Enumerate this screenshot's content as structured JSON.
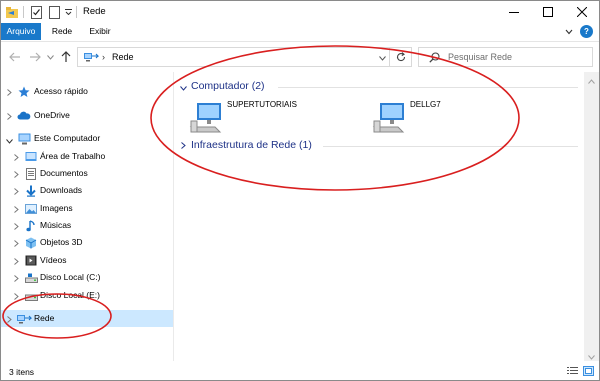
{
  "window": {
    "title": "Rede",
    "controls": {
      "minimize_icon": "minimize-icon",
      "maximize_icon": "maximize-icon",
      "close_icon": "close-icon"
    }
  },
  "ribbon": {
    "tabs": [
      {
        "label": "Arquivo",
        "active": true
      },
      {
        "label": "Rede",
        "active": false
      },
      {
        "label": "Exibir",
        "active": false
      }
    ]
  },
  "navigation": {
    "address_path": "Rede",
    "address_separator": "›",
    "search_placeholder": "Pesquisar Rede"
  },
  "sidebar": {
    "items": [
      {
        "label": "Acesso rápido",
        "icon": "star-icon",
        "selected": false
      },
      {
        "label": "OneDrive",
        "icon": "onedrive-cloud-icon",
        "selected": false
      },
      {
        "label": "Este Computador",
        "icon": "computer-icon",
        "selected": false,
        "expanded": true
      },
      {
        "label": "Área de Trabalho",
        "icon": "desktop-folder-icon",
        "selected": false
      },
      {
        "label": "Documentos",
        "icon": "documents-icon",
        "selected": false
      },
      {
        "label": "Downloads",
        "icon": "download-arrow-icon",
        "selected": false
      },
      {
        "label": "Imagens",
        "icon": "pictures-icon",
        "selected": false
      },
      {
        "label": "Músicas",
        "icon": "music-note-icon",
        "selected": false
      },
      {
        "label": "Objetos 3D",
        "icon": "3d-objects-icon",
        "selected": false
      },
      {
        "label": "Vídeos",
        "icon": "videos-icon",
        "selected": false
      },
      {
        "label": "Disco Local (C:)",
        "icon": "drive-icon",
        "selected": false
      },
      {
        "label": "Disco Local (E:)",
        "icon": "drive-icon",
        "selected": false
      },
      {
        "label": "Rede",
        "icon": "network-icon",
        "selected": true
      }
    ]
  },
  "content": {
    "groups": [
      {
        "title": "Computador (2)",
        "expanded": true,
        "items": [
          {
            "label": "SUPERTUTORIAIS",
            "icon": "computer-icon"
          },
          {
            "label": "DELLG7",
            "icon": "computer-icon"
          }
        ]
      },
      {
        "title": "Infraestrutura de Rede (1)",
        "expanded": false,
        "items": []
      }
    ]
  },
  "status": {
    "item_count": "3 itens"
  },
  "colors": {
    "accent": "#1979ca",
    "selection": "#cce8ff",
    "group_title": "#1e3287",
    "annotation": "#d91f1f"
  }
}
